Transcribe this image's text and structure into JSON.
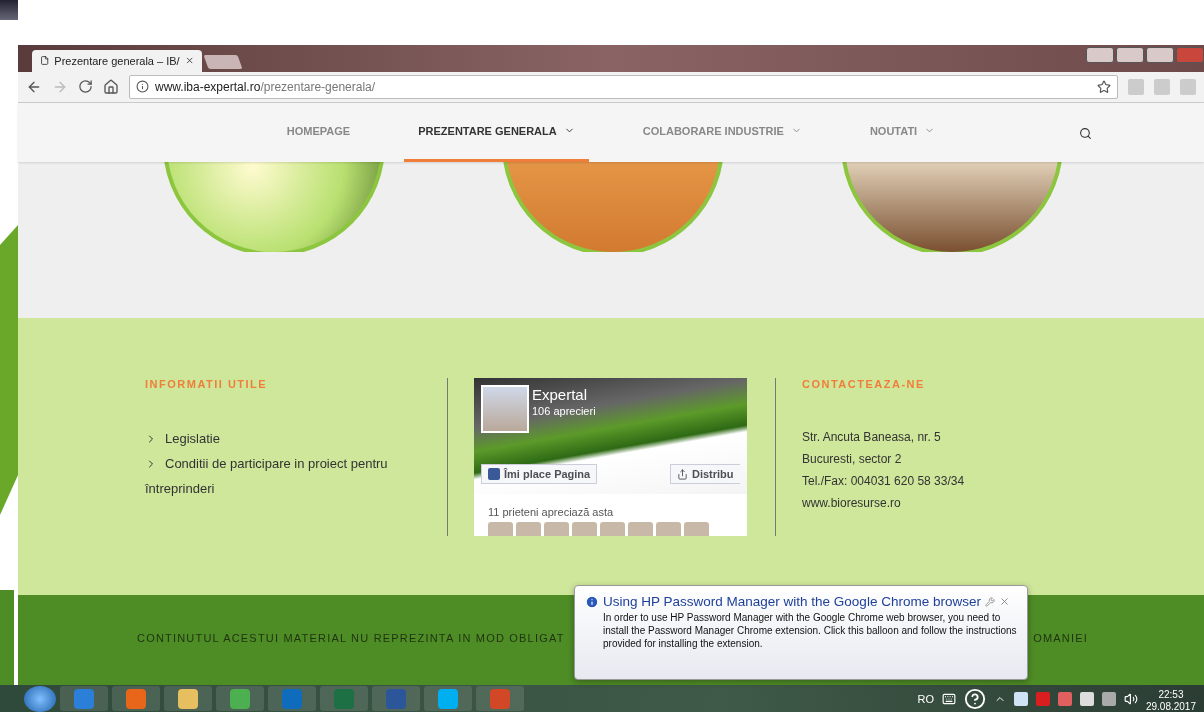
{
  "browser": {
    "tabs": [
      {
        "title": "Prezentare generala – IB/",
        "selected": true
      }
    ],
    "url": {
      "host": "www.iba-expertal.ro",
      "path": "/prezentare-generala/"
    }
  },
  "nav": {
    "items": [
      {
        "label": "HOMEPAGE",
        "selected": false,
        "dropdown": false
      },
      {
        "label": "PREZENTARE GENERALA",
        "selected": true,
        "dropdown": true
      },
      {
        "label": "COLABORARE INDUSTRIE",
        "selected": false,
        "dropdown": true
      },
      {
        "label": "NOUTATI",
        "selected": false,
        "dropdown": true
      }
    ]
  },
  "info": {
    "title": "INFORMATII UTILE",
    "links": [
      "Legislatie",
      "Conditii de participare in proiect pentru întreprinderi"
    ]
  },
  "facebook": {
    "page_name": "Expertal",
    "likes": "106 aprecieri",
    "like_button": "Îmi place Pagina",
    "share_button": "Distribu",
    "friends": "11 prieteni apreciază asta"
  },
  "contact": {
    "title": "CONTACTEAZA-NE",
    "lines": [
      "Str. Ancuta Baneasa, nr. 5",
      "Bucuresti, sector 2",
      "Tel./Fax: 004031 620 58 33/34",
      "www.bioresurse.ro"
    ]
  },
  "notice": {
    "left": "CONTINUTUL ACESTUI MATERIAL NU REPREZINTA IN MOD OBLIGAT",
    "right": "OMANIEI"
  },
  "balloon": {
    "title": "Using HP Password Manager with the Google Chrome browser",
    "body": "In order to use HP Password Manager with the Google Chrome web browser, you need to install the Password Manager Chrome extension. Click this balloon and follow the instructions provided for installing the extension."
  },
  "taskbar": {
    "language": "RO",
    "time": "22:53",
    "date": "29.08.2017"
  }
}
